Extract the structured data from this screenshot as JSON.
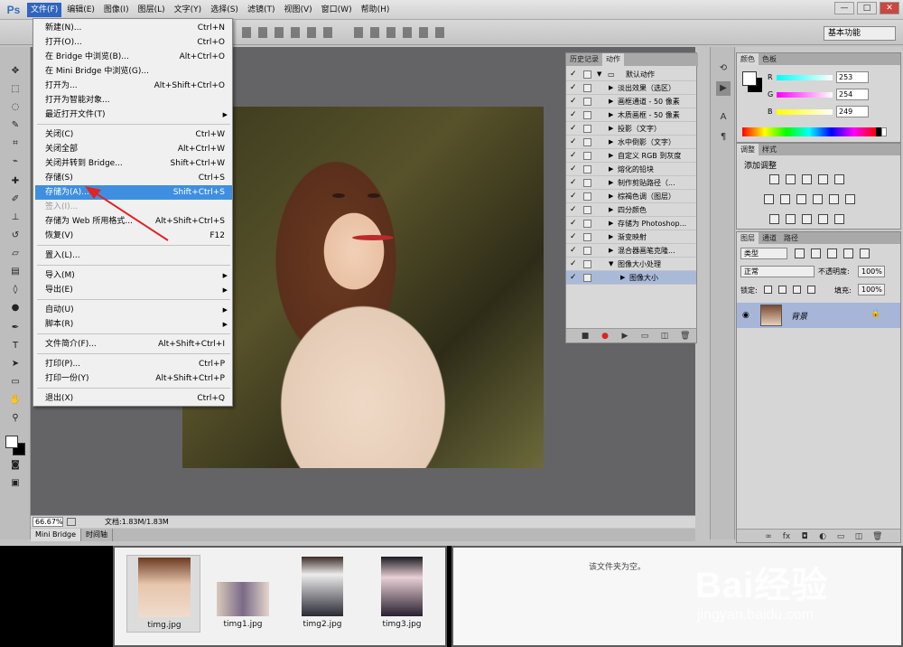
{
  "app": {
    "logo": "Ps"
  },
  "menubar": [
    {
      "label": "文件(F)",
      "active": true
    },
    {
      "label": "编辑(E)"
    },
    {
      "label": "图像(I)"
    },
    {
      "label": "图层(L)"
    },
    {
      "label": "文字(Y)"
    },
    {
      "label": "选择(S)"
    },
    {
      "label": "滤镜(T)"
    },
    {
      "label": "视图(V)"
    },
    {
      "label": "窗口(W)"
    },
    {
      "label": "帮助(H)"
    }
  ],
  "window_controls": {
    "minimize": "—",
    "maximize": "□",
    "close": "✕"
  },
  "workspace": {
    "value": "基本功能"
  },
  "file_menu": {
    "items": [
      {
        "label": "新建(N)...",
        "shortcut": "Ctrl+N"
      },
      {
        "label": "打开(O)...",
        "shortcut": "Ctrl+O"
      },
      {
        "label": "在 Bridge 中浏览(B)...",
        "shortcut": "Alt+Ctrl+O"
      },
      {
        "label": "在 Mini Bridge 中浏览(G)...",
        "shortcut": ""
      },
      {
        "label": "打开为...",
        "shortcut": "Alt+Shift+Ctrl+O"
      },
      {
        "label": "打开为智能对象...",
        "shortcut": ""
      },
      {
        "label": "最近打开文件(T)",
        "shortcut": "",
        "submenu": true
      },
      {
        "label": "关闭(C)",
        "shortcut": "Ctrl+W"
      },
      {
        "label": "关闭全部",
        "shortcut": "Alt+Ctrl+W"
      },
      {
        "label": "关闭并转到 Bridge...",
        "shortcut": "Shift+Ctrl+W"
      },
      {
        "label": "存储(S)",
        "shortcut": "Ctrl+S"
      },
      {
        "label": "存储为(A)...",
        "shortcut": "Shift+Ctrl+S",
        "highlight": true
      },
      {
        "label": "签入(I)...",
        "shortcut": "",
        "disabled": true
      },
      {
        "label": "存储为 Web 所用格式...",
        "shortcut": "Alt+Shift+Ctrl+S"
      },
      {
        "label": "恢复(V)",
        "shortcut": "F12"
      },
      {
        "label": "置入(L)...",
        "shortcut": ""
      },
      {
        "label": "导入(M)",
        "shortcut": "",
        "submenu": true
      },
      {
        "label": "导出(E)",
        "shortcut": "",
        "submenu": true
      },
      {
        "label": "自动(U)",
        "shortcut": "",
        "submenu": true
      },
      {
        "label": "脚本(R)",
        "shortcut": "",
        "submenu": true
      },
      {
        "label": "文件简介(F)...",
        "shortcut": "Alt+Shift+Ctrl+I"
      },
      {
        "label": "打印(P)...",
        "shortcut": "Ctrl+P"
      },
      {
        "label": "打印一份(Y)",
        "shortcut": "Alt+Shift+Ctrl+P"
      },
      {
        "label": "退出(X)",
        "shortcut": "Ctrl+Q"
      }
    ]
  },
  "actions_panel": {
    "tabs": [
      "历史记录",
      "动作"
    ],
    "rows": [
      {
        "label": "默认动作",
        "check": "✓",
        "level": 0
      },
      {
        "label": "淡出效果（选区）",
        "check": "✓",
        "level": 1
      },
      {
        "label": "画框通道 - 50 像素",
        "check": "✓",
        "level": 1
      },
      {
        "label": "木质画框 - 50 像素",
        "check": "✓",
        "level": 1
      },
      {
        "label": "投影（文字）",
        "check": "✓",
        "level": 1
      },
      {
        "label": "水中倒影（文字）",
        "check": "✓",
        "level": 1
      },
      {
        "label": "自定义 RGB 到灰度",
        "check": "✓",
        "level": 1
      },
      {
        "label": "熔化的铅块",
        "check": "✓",
        "level": 1
      },
      {
        "label": "制作剪贴路径（...",
        "check": "✓",
        "level": 1
      },
      {
        "label": "棕褐色调（图层）",
        "check": "✓",
        "level": 1
      },
      {
        "label": "四分颜色",
        "check": "✓",
        "level": 1
      },
      {
        "label": "存储为 Photoshop...",
        "check": "✓",
        "level": 1
      },
      {
        "label": "渐变映射",
        "check": "✓",
        "level": 1
      },
      {
        "label": "混合器画笔克隆...",
        "check": "✓",
        "level": 1
      },
      {
        "label": "图像大小处理",
        "check": "✓",
        "level": 1,
        "open": true
      },
      {
        "label": "图像大小",
        "check": "✓",
        "level": 2,
        "selected": true
      }
    ]
  },
  "color_panel": {
    "tabs": [
      "颜色",
      "色板"
    ],
    "channels": [
      {
        "name": "R",
        "value": "253"
      },
      {
        "name": "G",
        "value": "254"
      },
      {
        "name": "B",
        "value": "249"
      }
    ]
  },
  "adjust_panel": {
    "tabs": [
      "调整",
      "样式"
    ],
    "title": "添加调整"
  },
  "layers_panel": {
    "tabs": [
      "图层",
      "通道",
      "路径"
    ],
    "filter": "类型",
    "blend_mode": "正常",
    "opacity_label": "不透明度:",
    "opacity": "100%",
    "lock_label": "锁定:",
    "fill_label": "填充:",
    "fill": "100%",
    "layer_name": "背景"
  },
  "status": {
    "zoom": "66.67%",
    "doc": "文档:1.83M/1.83M"
  },
  "bottom_tabs": [
    "Mini Bridge",
    "时间轴"
  ],
  "bridge": {
    "thumbs": [
      {
        "name": "timg.jpg",
        "selected": true
      },
      {
        "name": "timg1.jpg"
      },
      {
        "name": "timg2.jpg"
      },
      {
        "name": "timg3.jpg"
      }
    ],
    "empty_msg": "该文件夹为空。"
  },
  "watermark": {
    "brand": "Bai经验",
    "url": "jingyan.baidu.com"
  }
}
